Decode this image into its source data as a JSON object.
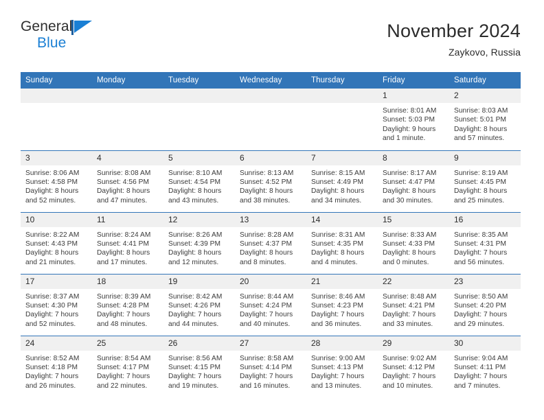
{
  "brand": {
    "name_part1": "General",
    "name_part2": "Blue",
    "logo_icon": "blue-triangle-flag-icon",
    "accent_color": "#1a7fd4"
  },
  "header": {
    "title": "November 2024",
    "location": "Zaykovo, Russia"
  },
  "theme": {
    "header_blue": "#3275b8",
    "daynum_band": "#f0f0f0",
    "text": "#2b2b2b"
  },
  "weekdays": [
    "Sunday",
    "Monday",
    "Tuesday",
    "Wednesday",
    "Thursday",
    "Friday",
    "Saturday"
  ],
  "calendar": {
    "month": "November",
    "year": 2024,
    "weeks": [
      [
        {
          "day": "",
          "empty": true
        },
        {
          "day": "",
          "empty": true
        },
        {
          "day": "",
          "empty": true
        },
        {
          "day": "",
          "empty": true
        },
        {
          "day": "",
          "empty": true
        },
        {
          "day": "1",
          "sunrise": "Sunrise: 8:01 AM",
          "sunset": "Sunset: 5:03 PM",
          "daylight1": "Daylight: 9 hours",
          "daylight2": "and 1 minute."
        },
        {
          "day": "2",
          "sunrise": "Sunrise: 8:03 AM",
          "sunset": "Sunset: 5:01 PM",
          "daylight1": "Daylight: 8 hours",
          "daylight2": "and 57 minutes."
        }
      ],
      [
        {
          "day": "3",
          "sunrise": "Sunrise: 8:06 AM",
          "sunset": "Sunset: 4:58 PM",
          "daylight1": "Daylight: 8 hours",
          "daylight2": "and 52 minutes."
        },
        {
          "day": "4",
          "sunrise": "Sunrise: 8:08 AM",
          "sunset": "Sunset: 4:56 PM",
          "daylight1": "Daylight: 8 hours",
          "daylight2": "and 47 minutes."
        },
        {
          "day": "5",
          "sunrise": "Sunrise: 8:10 AM",
          "sunset": "Sunset: 4:54 PM",
          "daylight1": "Daylight: 8 hours",
          "daylight2": "and 43 minutes."
        },
        {
          "day": "6",
          "sunrise": "Sunrise: 8:13 AM",
          "sunset": "Sunset: 4:52 PM",
          "daylight1": "Daylight: 8 hours",
          "daylight2": "and 38 minutes."
        },
        {
          "day": "7",
          "sunrise": "Sunrise: 8:15 AM",
          "sunset": "Sunset: 4:49 PM",
          "daylight1": "Daylight: 8 hours",
          "daylight2": "and 34 minutes."
        },
        {
          "day": "8",
          "sunrise": "Sunrise: 8:17 AM",
          "sunset": "Sunset: 4:47 PM",
          "daylight1": "Daylight: 8 hours",
          "daylight2": "and 30 minutes."
        },
        {
          "day": "9",
          "sunrise": "Sunrise: 8:19 AM",
          "sunset": "Sunset: 4:45 PM",
          "daylight1": "Daylight: 8 hours",
          "daylight2": "and 25 minutes."
        }
      ],
      [
        {
          "day": "10",
          "sunrise": "Sunrise: 8:22 AM",
          "sunset": "Sunset: 4:43 PM",
          "daylight1": "Daylight: 8 hours",
          "daylight2": "and 21 minutes."
        },
        {
          "day": "11",
          "sunrise": "Sunrise: 8:24 AM",
          "sunset": "Sunset: 4:41 PM",
          "daylight1": "Daylight: 8 hours",
          "daylight2": "and 17 minutes."
        },
        {
          "day": "12",
          "sunrise": "Sunrise: 8:26 AM",
          "sunset": "Sunset: 4:39 PM",
          "daylight1": "Daylight: 8 hours",
          "daylight2": "and 12 minutes."
        },
        {
          "day": "13",
          "sunrise": "Sunrise: 8:28 AM",
          "sunset": "Sunset: 4:37 PM",
          "daylight1": "Daylight: 8 hours",
          "daylight2": "and 8 minutes."
        },
        {
          "day": "14",
          "sunrise": "Sunrise: 8:31 AM",
          "sunset": "Sunset: 4:35 PM",
          "daylight1": "Daylight: 8 hours",
          "daylight2": "and 4 minutes."
        },
        {
          "day": "15",
          "sunrise": "Sunrise: 8:33 AM",
          "sunset": "Sunset: 4:33 PM",
          "daylight1": "Daylight: 8 hours",
          "daylight2": "and 0 minutes."
        },
        {
          "day": "16",
          "sunrise": "Sunrise: 8:35 AM",
          "sunset": "Sunset: 4:31 PM",
          "daylight1": "Daylight: 7 hours",
          "daylight2": "and 56 minutes."
        }
      ],
      [
        {
          "day": "17",
          "sunrise": "Sunrise: 8:37 AM",
          "sunset": "Sunset: 4:30 PM",
          "daylight1": "Daylight: 7 hours",
          "daylight2": "and 52 minutes."
        },
        {
          "day": "18",
          "sunrise": "Sunrise: 8:39 AM",
          "sunset": "Sunset: 4:28 PM",
          "daylight1": "Daylight: 7 hours",
          "daylight2": "and 48 minutes."
        },
        {
          "day": "19",
          "sunrise": "Sunrise: 8:42 AM",
          "sunset": "Sunset: 4:26 PM",
          "daylight1": "Daylight: 7 hours",
          "daylight2": "and 44 minutes."
        },
        {
          "day": "20",
          "sunrise": "Sunrise: 8:44 AM",
          "sunset": "Sunset: 4:24 PM",
          "daylight1": "Daylight: 7 hours",
          "daylight2": "and 40 minutes."
        },
        {
          "day": "21",
          "sunrise": "Sunrise: 8:46 AM",
          "sunset": "Sunset: 4:23 PM",
          "daylight1": "Daylight: 7 hours",
          "daylight2": "and 36 minutes."
        },
        {
          "day": "22",
          "sunrise": "Sunrise: 8:48 AM",
          "sunset": "Sunset: 4:21 PM",
          "daylight1": "Daylight: 7 hours",
          "daylight2": "and 33 minutes."
        },
        {
          "day": "23",
          "sunrise": "Sunrise: 8:50 AM",
          "sunset": "Sunset: 4:20 PM",
          "daylight1": "Daylight: 7 hours",
          "daylight2": "and 29 minutes."
        }
      ],
      [
        {
          "day": "24",
          "sunrise": "Sunrise: 8:52 AM",
          "sunset": "Sunset: 4:18 PM",
          "daylight1": "Daylight: 7 hours",
          "daylight2": "and 26 minutes."
        },
        {
          "day": "25",
          "sunrise": "Sunrise: 8:54 AM",
          "sunset": "Sunset: 4:17 PM",
          "daylight1": "Daylight: 7 hours",
          "daylight2": "and 22 minutes."
        },
        {
          "day": "26",
          "sunrise": "Sunrise: 8:56 AM",
          "sunset": "Sunset: 4:15 PM",
          "daylight1": "Daylight: 7 hours",
          "daylight2": "and 19 minutes."
        },
        {
          "day": "27",
          "sunrise": "Sunrise: 8:58 AM",
          "sunset": "Sunset: 4:14 PM",
          "daylight1": "Daylight: 7 hours",
          "daylight2": "and 16 minutes."
        },
        {
          "day": "28",
          "sunrise": "Sunrise: 9:00 AM",
          "sunset": "Sunset: 4:13 PM",
          "daylight1": "Daylight: 7 hours",
          "daylight2": "and 13 minutes."
        },
        {
          "day": "29",
          "sunrise": "Sunrise: 9:02 AM",
          "sunset": "Sunset: 4:12 PM",
          "daylight1": "Daylight: 7 hours",
          "daylight2": "and 10 minutes."
        },
        {
          "day": "30",
          "sunrise": "Sunrise: 9:04 AM",
          "sunset": "Sunset: 4:11 PM",
          "daylight1": "Daylight: 7 hours",
          "daylight2": "and 7 minutes."
        }
      ]
    ]
  }
}
